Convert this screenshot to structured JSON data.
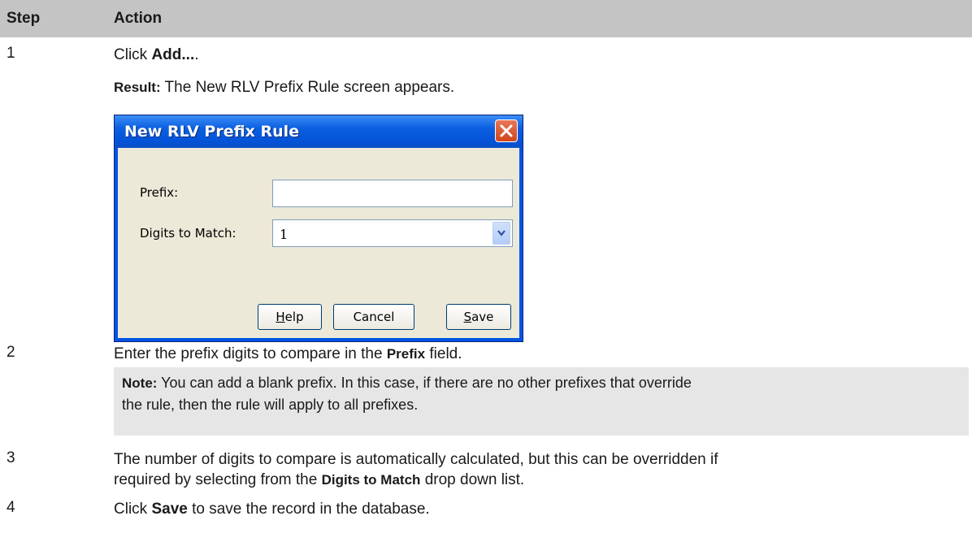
{
  "header": {
    "step": "Step",
    "action": "Action"
  },
  "steps": [
    {
      "num": "1",
      "pre": "Click ",
      "bold": "Add...",
      "post": "."
    },
    {
      "num": "2",
      "pre": "Enter the prefix digits to compare in the ",
      "bold": "Prefix",
      "post": " field."
    },
    {
      "num": "3",
      "line1": "The number of digits to compare is automatically calculated, but this can be overridden if",
      "line2_pre": "required by selecting from the ",
      "line2_bold": "Digits to Match",
      "line2_post": " drop down list."
    },
    {
      "num": "4",
      "pre": "Click ",
      "bold": "Save",
      "post": " to save the record in the database."
    }
  ],
  "result": {
    "label": "Result:",
    "text": " The New RLV Prefix Rule screen appears."
  },
  "note": {
    "label": "Note:",
    "line1": " You can add a blank prefix. In this case, if there are no other prefixes that override",
    "line2": "the rule, then the rule will apply to all prefixes."
  },
  "dialog": {
    "title": "New RLV Prefix Rule",
    "prefix_label": "Prefix:",
    "prefix_value": "",
    "digits_label": "Digits to Match:",
    "digits_value": "1",
    "help_label_u": "H",
    "help_label_rest": "elp",
    "cancel_label": "Cancel",
    "save_label_u": "S",
    "save_label_rest": "ave",
    "icons": {
      "close": "close-icon",
      "dropdown": "chevron-down-icon"
    }
  }
}
